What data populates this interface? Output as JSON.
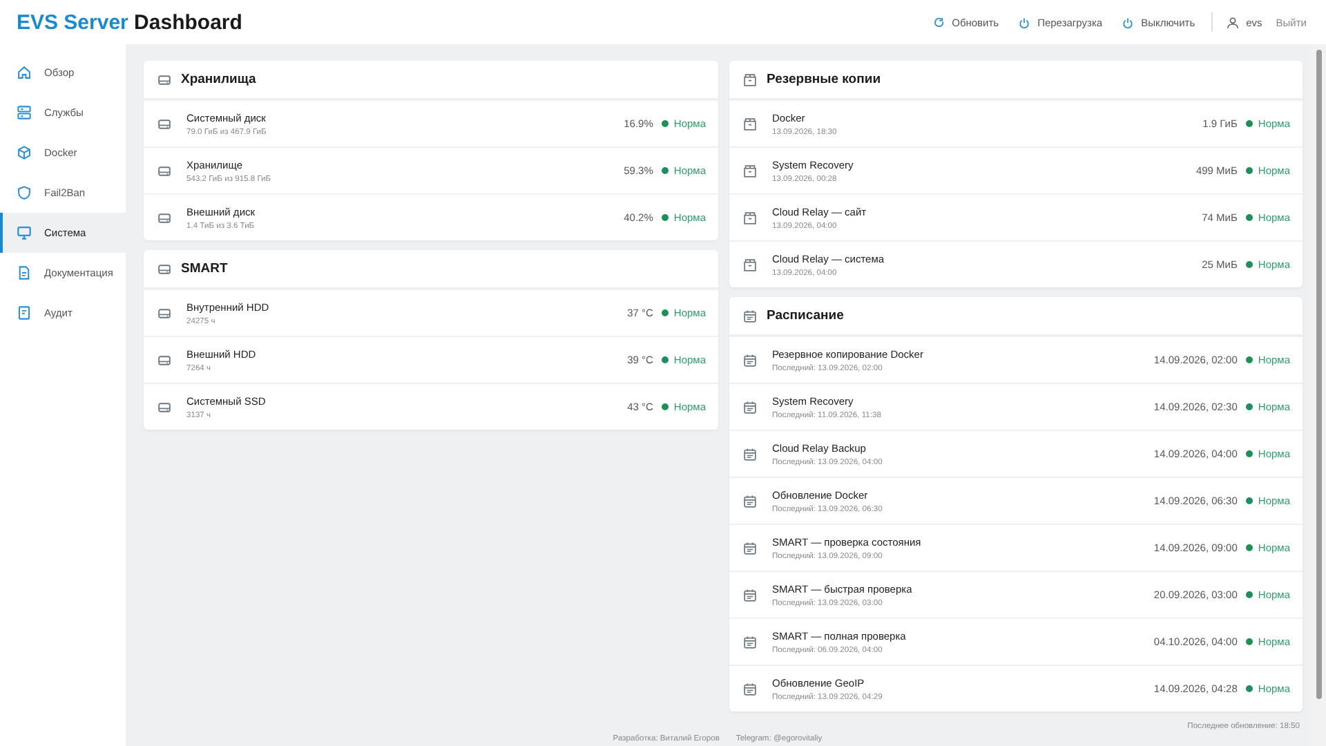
{
  "header": {
    "title_accent": "EVS Server",
    "title": "Dashboard",
    "actions": [
      {
        "kind": "refresh",
        "label": "Обновить"
      },
      {
        "kind": "power",
        "label": "Перезагрузка"
      },
      {
        "kind": "power",
        "label": "Выключить"
      }
    ],
    "user": "evs",
    "logout": "Выйти"
  },
  "sidebar": {
    "items": [
      {
        "kind": "home",
        "label": "Обзор",
        "selected": false
      },
      {
        "kind": "services",
        "label": "Службы",
        "selected": false
      },
      {
        "kind": "cube",
        "label": "Docker",
        "selected": false
      },
      {
        "kind": "shield",
        "label": "Fail2Ban",
        "selected": false
      },
      {
        "kind": "monitor",
        "label": "Система",
        "selected": true
      },
      {
        "kind": "doc",
        "label": "Документация",
        "selected": false
      },
      {
        "kind": "audit",
        "label": "Аудит",
        "selected": false
      }
    ]
  },
  "columns": [
    [
      {
        "title": "Хранилища",
        "kind": "disk",
        "rows": [
          {
            "name": "Системный диск",
            "detail": "79.0 ГиБ из 467.9 ГиБ",
            "value": "16.9%",
            "status": "Норма"
          },
          {
            "name": "Хранилище",
            "detail": "543.2 ГиБ из 915.8 ГиБ",
            "value": "59.3%",
            "status": "Норма"
          },
          {
            "name": "Внешний диск",
            "detail": "1.4 ТиБ из 3.6 ТиБ",
            "value": "40.2%",
            "status": "Норма"
          }
        ]
      },
      {
        "title": "SMART",
        "kind": "disk",
        "rows": [
          {
            "name": "Внутренний HDD",
            "detail": "24275 ч",
            "value": "37 °C",
            "status": "Норма"
          },
          {
            "name": "Внешний HDD",
            "detail": "7264 ч",
            "value": "39 °C",
            "status": "Норма"
          },
          {
            "name": "Системный SSD",
            "detail": "3137 ч",
            "value": "43 °C",
            "status": "Норма"
          }
        ]
      }
    ],
    [
      {
        "title": "Резервные копии",
        "kind": "backup",
        "rows": [
          {
            "name": "Docker",
            "detail": "13.09.2026, 18:30",
            "value": "1.9 ГиБ",
            "status": "Норма"
          },
          {
            "name": "System Recovery",
            "detail": "13.09.2026, 00:28",
            "value": "499 МиБ",
            "status": "Норма"
          },
          {
            "name": "Cloud Relay — сайт",
            "detail": "13.09.2026, 04:00",
            "value": "74 МиБ",
            "status": "Норма"
          },
          {
            "name": "Cloud Relay — система",
            "detail": "13.09.2026, 04:00",
            "value": "25 МиБ",
            "status": "Норма"
          }
        ]
      },
      {
        "title": "Расписание",
        "kind": "calendar",
        "rows": [
          {
            "name": "Резервное копирование Docker",
            "detail": "Последний: 13.09.2026, 02:00",
            "value": "14.09.2026, 02:00",
            "status": "Норма"
          },
          {
            "name": "System Recovery",
            "detail": "Последний: 11.09.2026, 11:38",
            "value": "14.09.2026, 02:30",
            "status": "Норма"
          },
          {
            "name": "Cloud Relay Backup",
            "detail": "Последний: 13.09.2026, 04:00",
            "value": "14.09.2026, 04:00",
            "status": "Норма"
          },
          {
            "name": "Обновление Docker",
            "detail": "Последний: 13.09.2026, 06:30",
            "value": "14.09.2026, 06:30",
            "status": "Норма"
          },
          {
            "name": "SMART — проверка состояния",
            "detail": "Последний: 13.09.2026, 09:00",
            "value": "14.09.2026, 09:00",
            "status": "Норма"
          },
          {
            "name": "SMART — быстрая проверка",
            "detail": "Последний: 13.09.2026, 03:00",
            "value": "20.09.2026, 03:00",
            "status": "Норма"
          },
          {
            "name": "SMART — полная проверка",
            "detail": "Последний: 06.09.2026, 04:00",
            "value": "04.10.2026, 04:00",
            "status": "Норма"
          },
          {
            "name": "Обновление GeoIP",
            "detail": "Последний: 13.09.2026, 04:29",
            "value": "14.09.2026, 04:28",
            "status": "Норма"
          }
        ]
      }
    ]
  ],
  "last_update": "Последнее обновление: 18:50",
  "footer": [
    "Разработка: Виталий Егоров",
    "Telegram: @egorovitaliy"
  ]
}
